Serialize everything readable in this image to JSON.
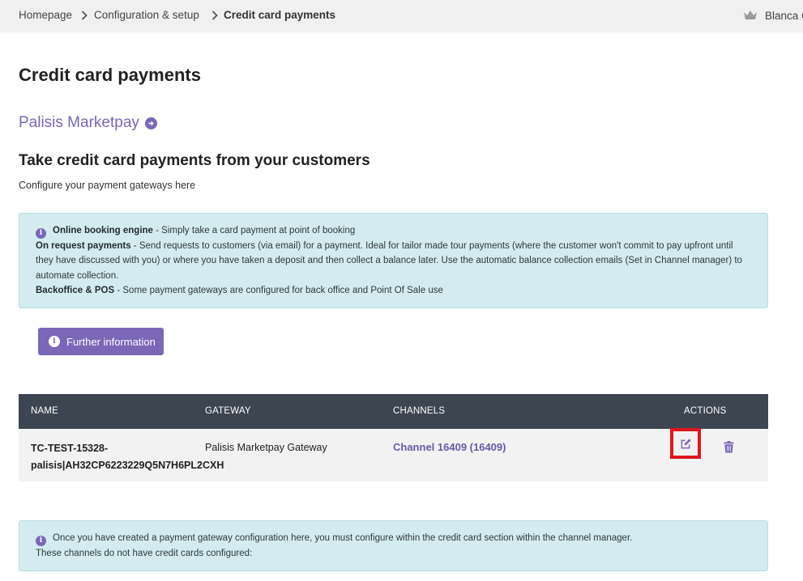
{
  "breadcrumb": {
    "items": [
      "Homepage",
      "Configuration & setup",
      "Credit card payments"
    ]
  },
  "user": {
    "name": "Blanca C",
    "icon": "crown-icon"
  },
  "page": {
    "title": "Credit card payments",
    "marketpay_link": "Palisis Marketpay",
    "subheading": "Take credit card payments from your customers",
    "subtext": "Configure your payment gateways here"
  },
  "info_top": {
    "online_label": "Online booking engine",
    "online_text": " - Simply take a card payment at point of booking",
    "request_label": "On request payments",
    "request_text": " - Send requests to customers (via email) for a payment. Ideal for tailor made tour payments (where the customer won't commit to pay upfront until they have discussed with you) or where you have taken a deposit and then collect a balance later. Use the automatic balance collection emails (Set in Channel manager) to automate collection.",
    "backoffice_label": "Backoffice & POS",
    "backoffice_text": " - Some payment gateways are configured for back office and Point Of Sale use"
  },
  "further_button": "Further information",
  "table": {
    "headers": {
      "name": "NAME",
      "gateway": "GATEWAY",
      "channels": "CHANNELS",
      "actions": "ACTIONS"
    },
    "rows": [
      {
        "name": "TC-TEST-15328-palisis|AH32CP6223229Q5N7H6PL2CXH",
        "gateway": "Palisis Marketpay Gateway",
        "channel": "Channel 16409 (16409)"
      }
    ]
  },
  "info_bottom": {
    "line1": "Once you have created a payment gateway configuration here, you must configure within the credit card section within the channel manager.",
    "line2": "These channels do not have credit cards configured:"
  },
  "colors": {
    "accent": "#7a67b8",
    "table_header": "#3c4550",
    "info_bg": "#d3ecef",
    "highlight": "#e0141e"
  }
}
